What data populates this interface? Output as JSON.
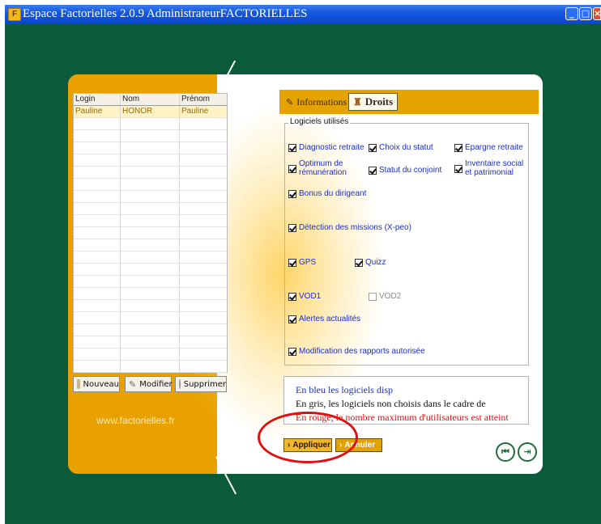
{
  "window": {
    "title": "Espace Factorielles 2.0.9  AdministrateurFACTORIELLES",
    "app_icon": "F",
    "controls": [
      "minimize-icon",
      "maximize-icon",
      "close-icon"
    ]
  },
  "users_table": {
    "columns": [
      "Login",
      "Nom",
      "Prénom"
    ],
    "rows": [
      [
        "Pauline",
        "HONOR",
        "Pauline"
      ]
    ]
  },
  "user_buttons": {
    "new": "Nouveau",
    "edit": "Modifier",
    "delete": "Supprimer"
  },
  "site_url": "www.factorielles.fr",
  "tabs": {
    "informations": "Informations",
    "droits": "Droits"
  },
  "software_group": {
    "legend": "Logiciels utilisés",
    "items": [
      {
        "label": "Diagnostic retraite",
        "checked": true,
        "enabled": true
      },
      {
        "label": "Choix du statut",
        "checked": true,
        "enabled": true
      },
      {
        "label": "Epargne retraite",
        "checked": true,
        "enabled": true
      },
      {
        "label": "Optimum de rémunération",
        "checked": true,
        "enabled": true
      },
      {
        "label": "Statut du conjoint",
        "checked": true,
        "enabled": true
      },
      {
        "label": "Inventaire social et patrimonial",
        "checked": true,
        "enabled": true
      },
      {
        "label": "Bonus du dirigeant",
        "checked": true,
        "enabled": true
      },
      {
        "label": "Détection des missions (X-peo)",
        "checked": true,
        "enabled": true
      },
      {
        "label": "GPS",
        "checked": true,
        "enabled": true
      },
      {
        "label": "Quizz",
        "checked": true,
        "enabled": true
      },
      {
        "label": "VOD1",
        "checked": true,
        "enabled": true
      },
      {
        "label": "VOD2",
        "checked": false,
        "enabled": false
      },
      {
        "label": "Alertes actualités",
        "checked": true,
        "enabled": true
      },
      {
        "label": "Modification des rapports autorisée",
        "checked": true,
        "enabled": true
      }
    ]
  },
  "legend_box": {
    "line1": "En bleu les logiciels disp",
    "line2": "En gris, les logiciels non choisis dans le cadre de",
    "line3": "En rouge, le nombre maximum d'utilisateurs est atteint"
  },
  "actions": {
    "apply": "Appliquer",
    "cancel": "Annuler"
  },
  "nav_buttons": [
    "rewind-icon",
    "exit-icon"
  ],
  "colors": {
    "background": "#0b5a3c",
    "accent": "#e9a100",
    "available": "#1a2fc8",
    "unavailable": "#8d8d8d",
    "limit": "#e01010"
  }
}
